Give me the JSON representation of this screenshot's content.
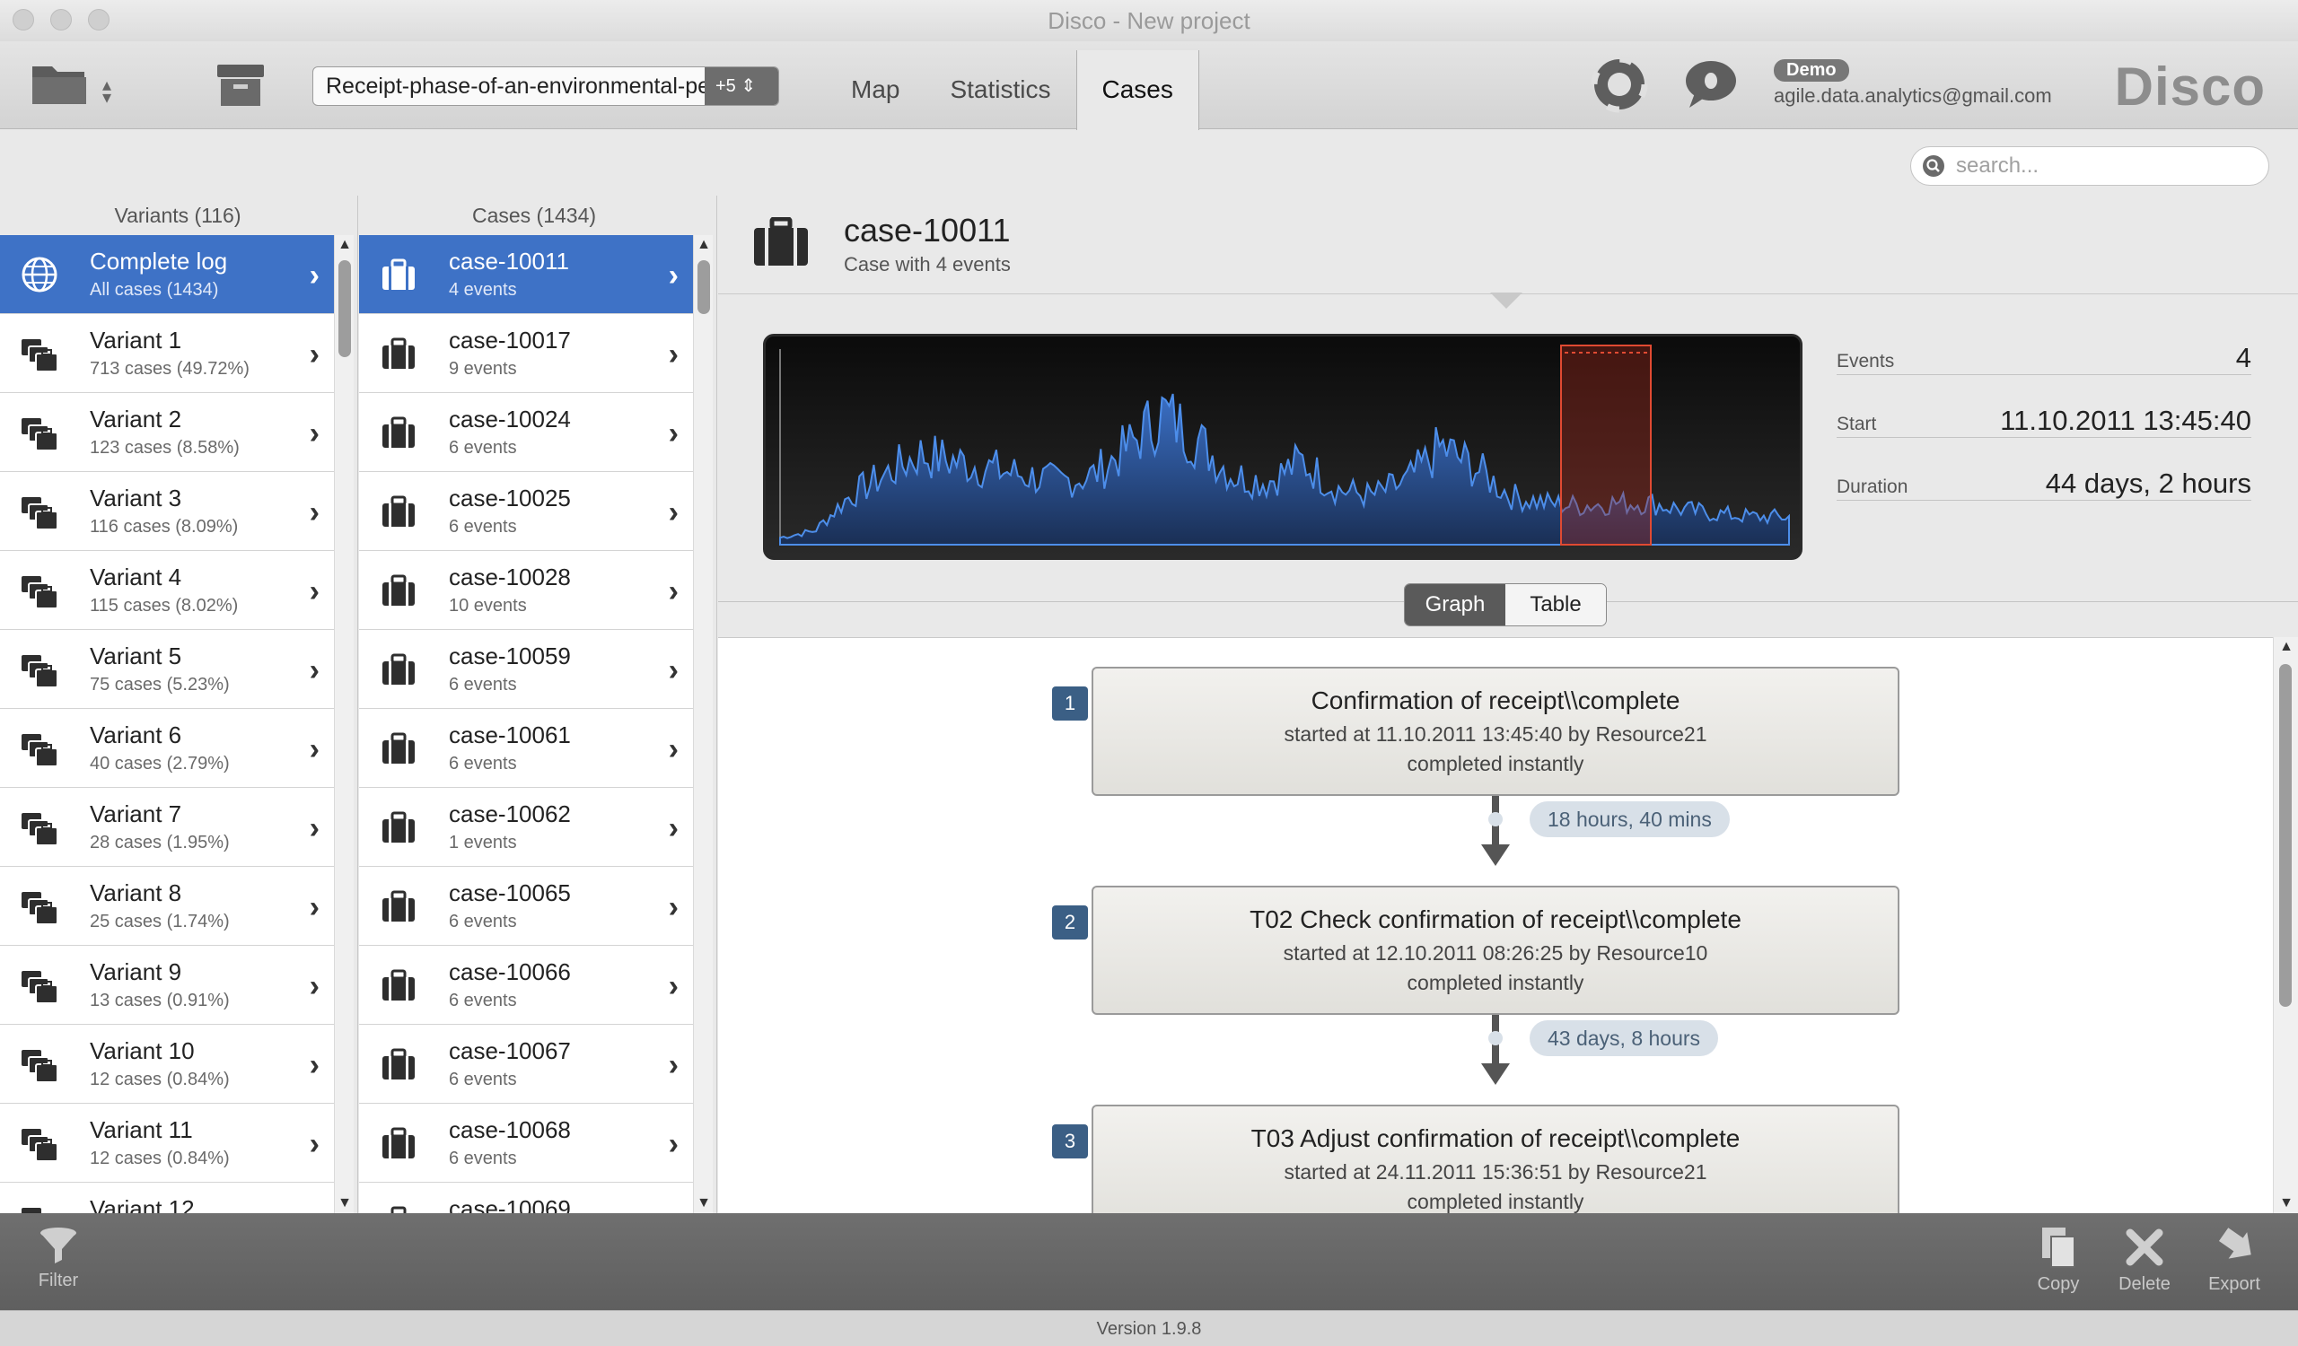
{
  "window": {
    "title": "Disco - New project"
  },
  "toolbar": {
    "dataset": "Receipt-phase-of-an-environmental-pe",
    "dataset_more": "+5",
    "tabs": [
      {
        "label": "Map"
      },
      {
        "label": "Statistics"
      },
      {
        "label": "Cases"
      }
    ],
    "active_tab": "Cases",
    "badge": "Demo",
    "email": "agile.data.analytics@gmail.com",
    "brand": "Disco"
  },
  "search": {
    "placeholder": "search..."
  },
  "variants": {
    "header": "Variants (116)",
    "items": [
      {
        "title": "Complete log",
        "sub": "All cases (1434)"
      },
      {
        "title": "Variant 1",
        "sub": "713 cases (49.72%)"
      },
      {
        "title": "Variant 2",
        "sub": "123 cases (8.58%)"
      },
      {
        "title": "Variant 3",
        "sub": "116 cases (8.09%)"
      },
      {
        "title": "Variant 4",
        "sub": "115 cases (8.02%)"
      },
      {
        "title": "Variant 5",
        "sub": "75 cases (5.23%)"
      },
      {
        "title": "Variant 6",
        "sub": "40 cases (2.79%)"
      },
      {
        "title": "Variant 7",
        "sub": "28 cases (1.95%)"
      },
      {
        "title": "Variant 8",
        "sub": "25 cases (1.74%)"
      },
      {
        "title": "Variant 9",
        "sub": "13 cases (0.91%)"
      },
      {
        "title": "Variant 10",
        "sub": "12 cases (0.84%)"
      },
      {
        "title": "Variant 11",
        "sub": "12 cases (0.84%)"
      },
      {
        "title": "Variant 12",
        "sub": ""
      }
    ]
  },
  "cases": {
    "header": "Cases (1434)",
    "items": [
      {
        "title": "case-10011",
        "sub": "4 events"
      },
      {
        "title": "case-10017",
        "sub": "9 events"
      },
      {
        "title": "case-10024",
        "sub": "6 events"
      },
      {
        "title": "case-10025",
        "sub": "6 events"
      },
      {
        "title": "case-10028",
        "sub": "10 events"
      },
      {
        "title": "case-10059",
        "sub": "6 events"
      },
      {
        "title": "case-10061",
        "sub": "6 events"
      },
      {
        "title": "case-10062",
        "sub": "1 events"
      },
      {
        "title": "case-10065",
        "sub": "6 events"
      },
      {
        "title": "case-10066",
        "sub": "6 events"
      },
      {
        "title": "case-10067",
        "sub": "6 events"
      },
      {
        "title": "case-10068",
        "sub": "6 events"
      },
      {
        "title": "case-10069",
        "sub": ""
      }
    ]
  },
  "detail": {
    "title": "case-10011",
    "subtitle": "Case with 4 events",
    "stats": [
      {
        "label": "Events",
        "value": "4"
      },
      {
        "label": "Start",
        "value": "11.10.2011 13:45:40"
      },
      {
        "label": "Duration",
        "value": "44 days, 2 hours"
      }
    ],
    "view_graph": "Graph",
    "view_table": "Table",
    "events": [
      {
        "num": "1",
        "title": "Confirmation of receipt\\\\complete",
        "started": "started at 11.10.2011 13:45:40 by Resource21",
        "completed": "completed instantly"
      },
      {
        "num": "2",
        "title": "T02 Check confirmation of receipt\\\\complete",
        "started": "started at 12.10.2011 08:26:25 by Resource10",
        "completed": "completed instantly"
      },
      {
        "num": "3",
        "title": "T03 Adjust confirmation of receipt\\\\complete",
        "started": "started at 24.11.2011 15:36:51 by Resource21",
        "completed": "completed instantly"
      }
    ],
    "durations": [
      "18 hours, 40 mins",
      "43 days, 8 hours"
    ]
  },
  "bottom": {
    "filter": "Filter",
    "copy": "Copy",
    "delete": "Delete",
    "export": "Export"
  },
  "status": {
    "version": "Version 1.9.8"
  },
  "colors": {
    "selection": "#3e72c6",
    "timeline_series": "#3b78d8",
    "timeline_highlight": "#d0301e"
  }
}
